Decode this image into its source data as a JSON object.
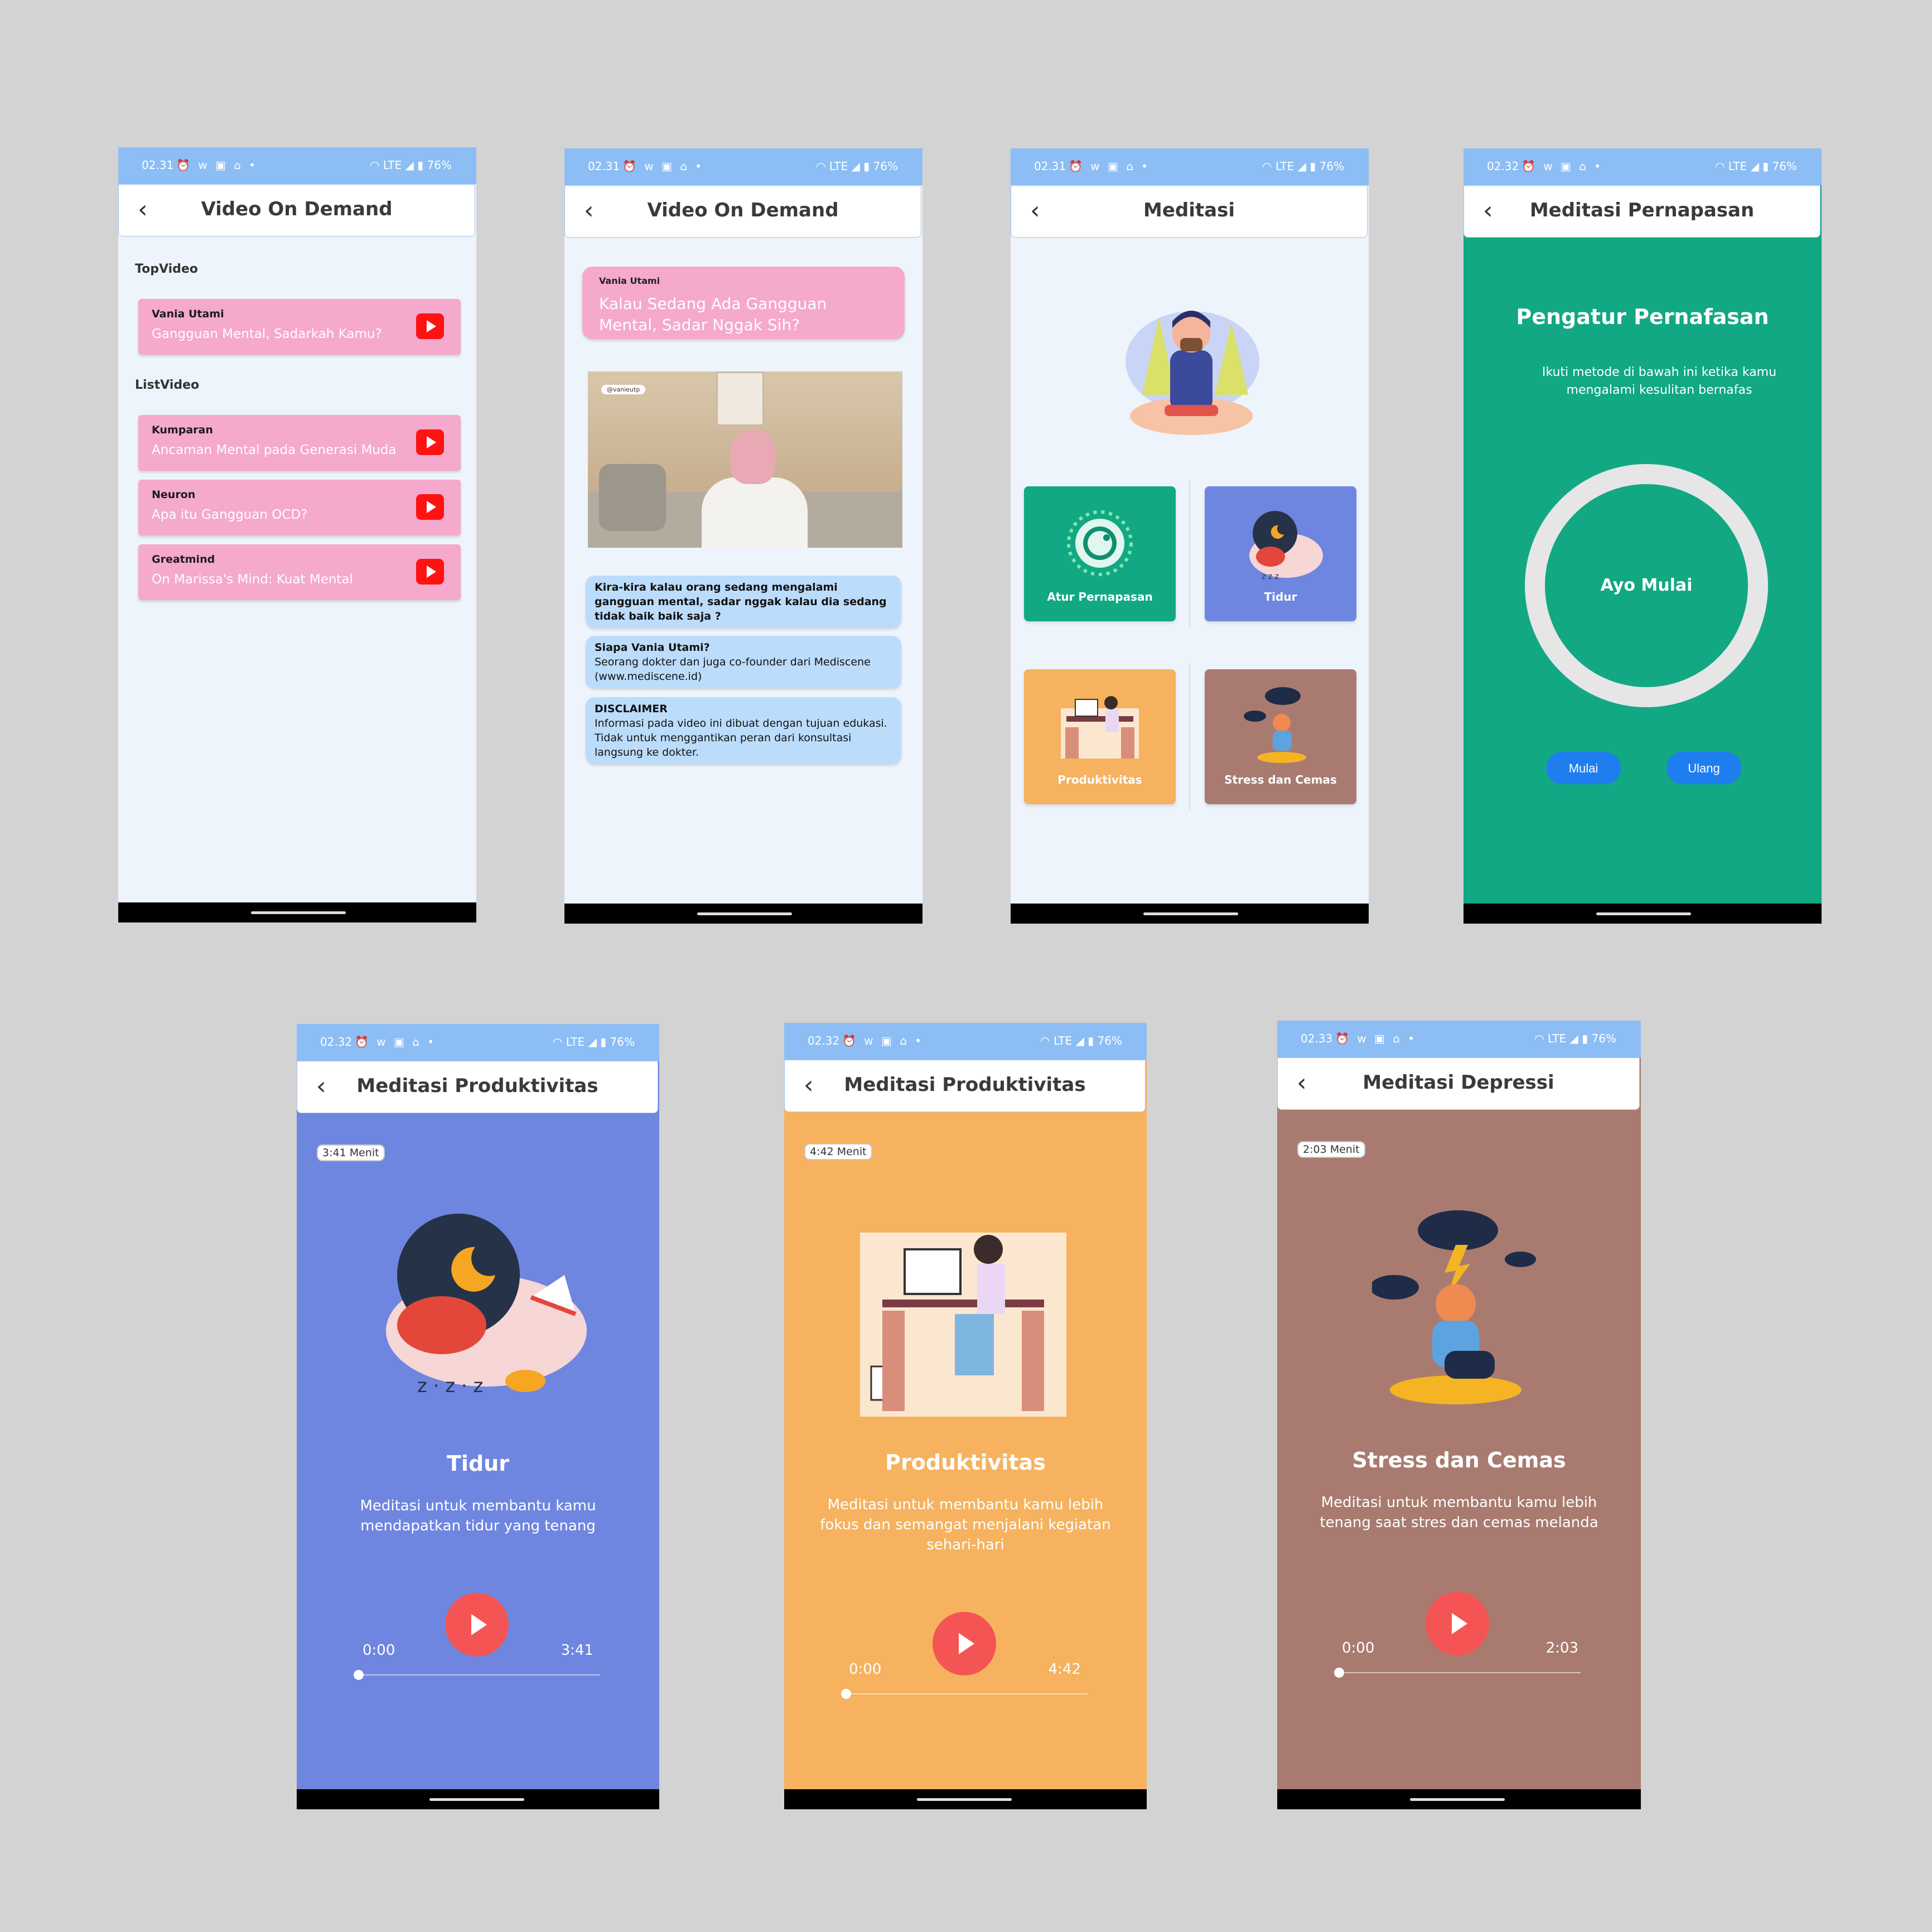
{
  "colors": {
    "background": "#d3d3d3",
    "statusbar": "#8cbef5",
    "screen_bg": "#eef4fb",
    "pink_card": "#f4a9cd",
    "bubble": "#bcdcfb",
    "green": "#12a883",
    "blue_tile": "#6f86e0",
    "orange": "#f6b25e",
    "brown": "#a97b70",
    "play_red": "#f45454",
    "action_blue": "#1e7ef0"
  },
  "statusbar": {
    "icons_left": "⏰ ᴡ ▣ ⌂ •",
    "icons_right": "◠ LTE ◢ ▮ 76%"
  },
  "screen1": {
    "time": "02.31",
    "title": "Video On Demand",
    "top_label": "TopVideo",
    "list_label": "ListVideo",
    "top_video": {
      "source": "Vania Utami",
      "title": "Gangguan Mental, Sadarkah Kamu?"
    },
    "list_videos": [
      {
        "source": "Kumparan",
        "title": "Ancaman Mental pada Generasi Muda"
      },
      {
        "source": "Neuron",
        "title": "Apa itu Gangguan OCD?"
      },
      {
        "source": "Greatmind",
        "title": "On Marissa's Mind: Kuat Mental"
      }
    ]
  },
  "screen2": {
    "time": "02.31",
    "title": "Video On Demand",
    "header_source": "Vania Utami",
    "header_title": "Kalau Sedang Ada Gangguan Mental, Sadar Nggak Sih?",
    "video_tag": "@vanieutp",
    "question": "Kira-kira kalau orang sedang mengalami gangguan mental, sadar nggak kalau dia sedang tidak baik baik saja ?",
    "who_title": "Siapa Vania Utami?",
    "who_text": "Seorang dokter dan juga co-founder dari  Mediscene (www.mediscene.id)",
    "disclaimer_title": "DISCLAIMER",
    "disclaimer_text": "Informasi pada video ini dibuat dengan tujuan edukasi. Tidak untuk menggantikan peran dari konsultasi langsung ke dokter."
  },
  "screen3": {
    "time": "02.31",
    "title": "Meditasi",
    "tiles": [
      {
        "label": "Atur Pernapasan",
        "color": "#12a883"
      },
      {
        "label": "Tidur",
        "color": "#6f86e0"
      },
      {
        "label": "Produktivitas",
        "color": "#f6b25e"
      },
      {
        "label": "Stress dan Cemas",
        "color": "#a97b70"
      }
    ]
  },
  "screen4": {
    "time": "02.32",
    "title": "Meditasi Pernapasan",
    "heading": "Pengatur Pernafasan",
    "subtitle": "Ikuti metode di bawah ini ketika kamu mengalami kesulitan bernafas",
    "ring_label": "Ayo Mulai",
    "start_label": "Mulai",
    "reset_label": "Ulang"
  },
  "screen5": {
    "time": "02.32",
    "title": "Meditasi Produktivitas",
    "badge": "3:41 Menit",
    "heading": "Tidur",
    "desc": "Meditasi untuk membantu kamu mendapatkan tidur yang tenang",
    "time_start": "0:00",
    "time_end": "3:41",
    "progress": 0
  },
  "screen6": {
    "time": "02.32",
    "title": "Meditasi Produktivitas",
    "badge": "4:42 Menit",
    "heading": "Produktivitas",
    "desc": "Meditasi untuk  membantu kamu lebih fokus dan semangat menjalani kegiatan sehari-hari",
    "time_start": "0:00",
    "time_end": "4:42",
    "progress": 0
  },
  "screen7": {
    "time": "02.33",
    "title": "Meditasi Depressi",
    "badge": "2:03 Menit",
    "heading": "Stress dan Cemas",
    "desc": "Meditasi untuk membantu kamu lebih tenang saat stres dan cemas melanda",
    "time_start": "0:00",
    "time_end": "2:03",
    "progress": 0
  }
}
